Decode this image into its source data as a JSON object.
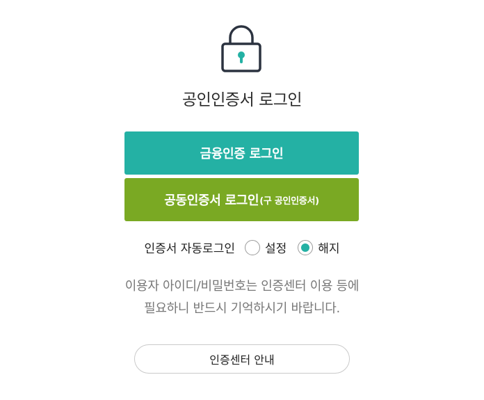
{
  "header": {
    "icon": "lock-icon",
    "title": "공인인증서 로그인"
  },
  "buttons": {
    "finance_login": "금융인증 로그인",
    "joint_login_main": "공동인증서 로그인",
    "joint_login_sub": "(구 공인인증서)"
  },
  "auto_login": {
    "label": "인증서 자동로그인",
    "options": [
      {
        "label": "설정",
        "selected": false
      },
      {
        "label": "해지",
        "selected": true
      }
    ]
  },
  "notice": {
    "line1": "이용자 아이디/비밀번호는 인증센터 이용 등에",
    "line2": "필요하니 반드시 기억하시기 바랍니다."
  },
  "guide_button": "인증센터 안내",
  "colors": {
    "finance_button": "#24b1a4",
    "joint_button": "#7aa923",
    "radio_selected": "#24b1a4",
    "lock_body": "#2c3340",
    "keyhole": "#24b1a4"
  }
}
